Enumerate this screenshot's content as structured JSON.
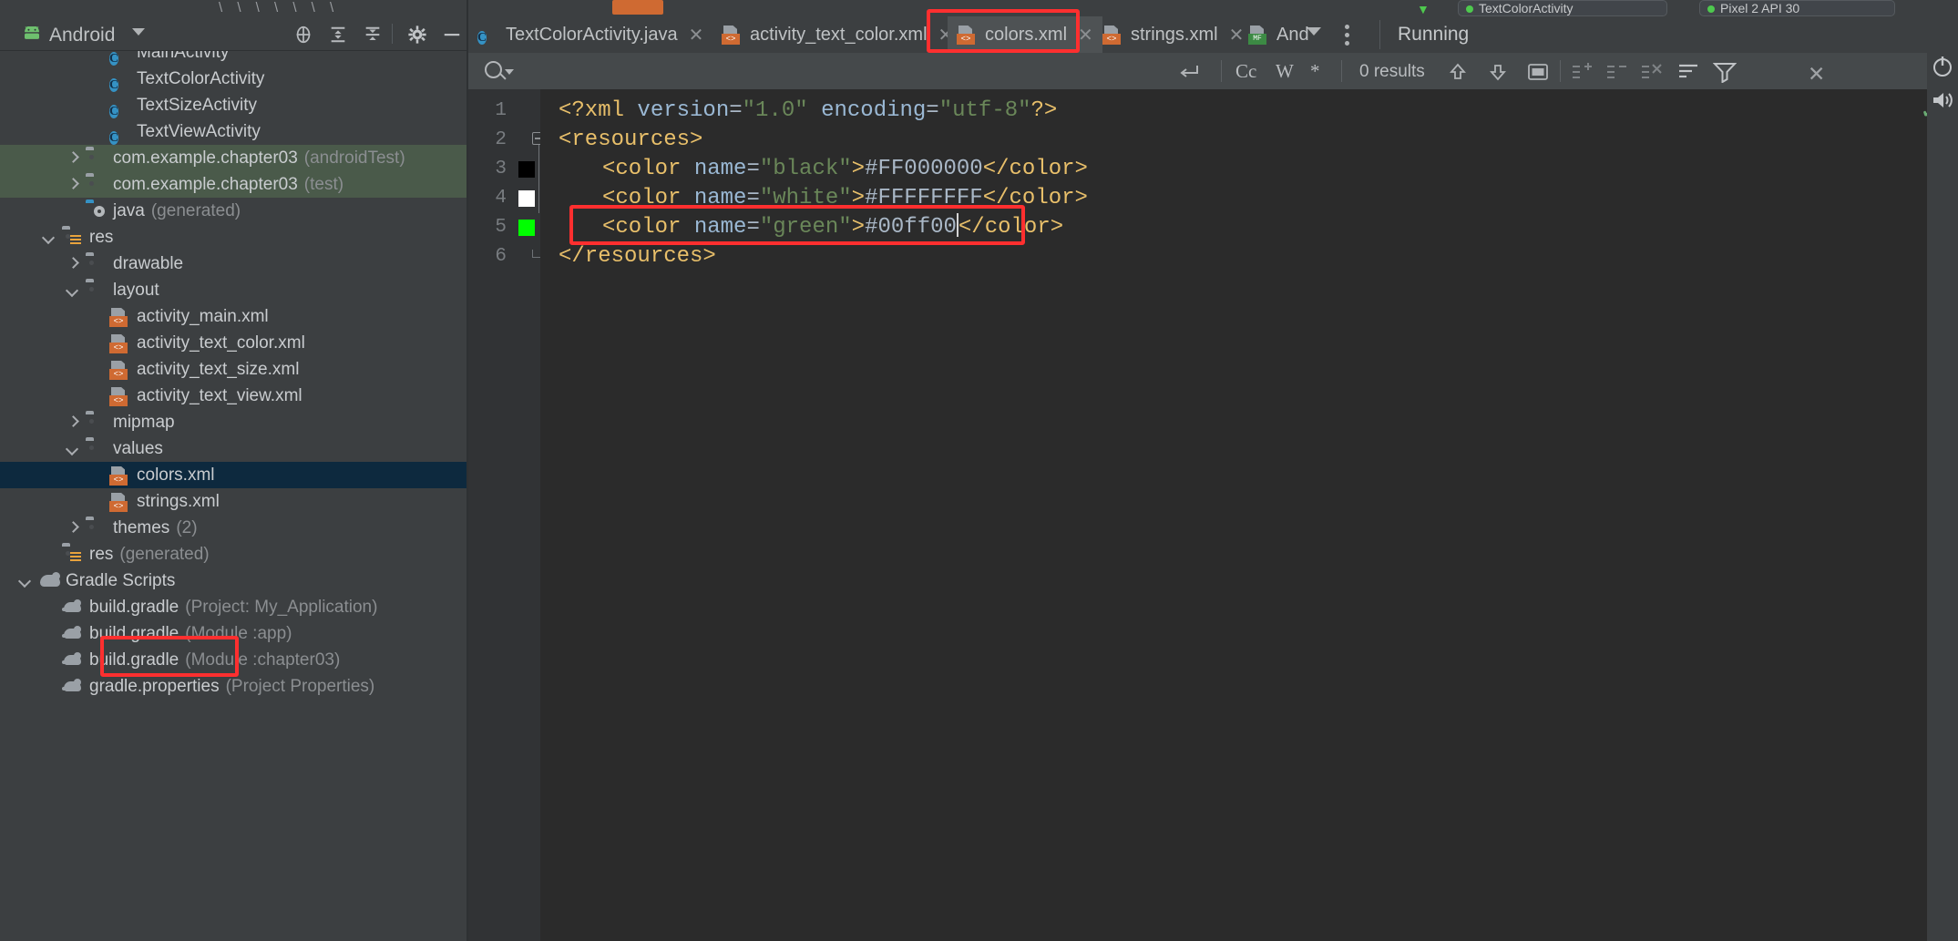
{
  "window": {
    "background": "#3c3f41",
    "editor_background": "#2b2b2b"
  },
  "top_sliver": {
    "breadcrumb_separators": "\\   \\   \\   \\   \\   \\   \\",
    "chip_running_label": "TextColorActivity",
    "chip_device_label": "Pixel 2 API 30"
  },
  "project_panel": {
    "title": "Android",
    "droid_icon": "android-robot-icon",
    "caret_icon": "chevron-down-icon",
    "header_icons": [
      {
        "name": "locate-in-tree-icon",
        "glyph": "target"
      },
      {
        "name": "expand-all-icon",
        "glyph": "expand"
      },
      {
        "name": "collapse-all-icon",
        "glyph": "collapse"
      },
      {
        "name": "settings-gear-icon",
        "glyph": "gear"
      },
      {
        "name": "hide-panel-icon",
        "glyph": "minus"
      }
    ],
    "tree": [
      {
        "indent": 3,
        "chevron": "none",
        "icon": "java-class-icon",
        "label": "MainActivity",
        "sub": "",
        "state": "normal",
        "cut_top": true
      },
      {
        "indent": 3,
        "chevron": "none",
        "icon": "java-class-icon",
        "label": "TextColorActivity",
        "sub": "",
        "state": "normal"
      },
      {
        "indent": 3,
        "chevron": "none",
        "icon": "java-class-icon",
        "label": "TextSizeActivity",
        "sub": "",
        "state": "normal"
      },
      {
        "indent": 3,
        "chevron": "none",
        "icon": "java-class-icon",
        "label": "TextViewActivity",
        "sub": "",
        "state": "normal"
      },
      {
        "indent": 2,
        "chevron": "right",
        "icon": "folder-icon",
        "label": "com.example.chapter03",
        "sub": "(androidTest)",
        "state": "selected-green"
      },
      {
        "indent": 2,
        "chevron": "right",
        "icon": "folder-icon",
        "label": "com.example.chapter03",
        "sub": "(test)",
        "state": "selected-green"
      },
      {
        "indent": 2,
        "chevron": "none",
        "icon": "java-generated-folder-icon",
        "label": "java",
        "sub": "(generated)",
        "state": "normal"
      },
      {
        "indent": 1,
        "chevron": "down",
        "icon": "res-folder-icon",
        "label": "res",
        "sub": "",
        "state": "normal"
      },
      {
        "indent": 2,
        "chevron": "right",
        "icon": "folder-icon",
        "label": "drawable",
        "sub": "",
        "state": "normal"
      },
      {
        "indent": 2,
        "chevron": "down",
        "icon": "folder-icon",
        "label": "layout",
        "sub": "",
        "state": "normal"
      },
      {
        "indent": 3,
        "chevron": "none",
        "icon": "xml-layout-icon",
        "label": "activity_main.xml",
        "sub": "",
        "state": "normal"
      },
      {
        "indent": 3,
        "chevron": "none",
        "icon": "xml-layout-icon",
        "label": "activity_text_color.xml",
        "sub": "",
        "state": "normal"
      },
      {
        "indent": 3,
        "chevron": "none",
        "icon": "xml-layout-icon",
        "label": "activity_text_size.xml",
        "sub": "",
        "state": "normal"
      },
      {
        "indent": 3,
        "chevron": "none",
        "icon": "xml-layout-icon",
        "label": "activity_text_view.xml",
        "sub": "",
        "state": "normal"
      },
      {
        "indent": 2,
        "chevron": "right",
        "icon": "folder-icon",
        "label": "mipmap",
        "sub": "",
        "state": "normal"
      },
      {
        "indent": 2,
        "chevron": "down",
        "icon": "folder-icon",
        "label": "values",
        "sub": "",
        "state": "normal"
      },
      {
        "indent": 3,
        "chevron": "none",
        "icon": "xml-layout-icon",
        "label": "colors.xml",
        "sub": "",
        "state": "selected-blue",
        "annotated": true
      },
      {
        "indent": 3,
        "chevron": "none",
        "icon": "xml-layout-icon",
        "label": "strings.xml",
        "sub": "",
        "state": "normal"
      },
      {
        "indent": 2,
        "chevron": "right",
        "icon": "folder-icon",
        "label": "themes",
        "sub": "(2)",
        "state": "normal"
      },
      {
        "indent": 1,
        "chevron": "none",
        "icon": "res-generated-folder-icon",
        "label": "res",
        "sub": "(generated)",
        "state": "normal"
      },
      {
        "indent": 0,
        "chevron": "down",
        "icon": "gradle-scripts-icon",
        "label": "Gradle Scripts",
        "sub": "",
        "state": "normal"
      },
      {
        "indent": 1,
        "chevron": "none",
        "icon": "gradle-file-icon",
        "label": "build.gradle",
        "sub": "(Project: My_Application)",
        "state": "normal"
      },
      {
        "indent": 1,
        "chevron": "none",
        "icon": "gradle-file-icon",
        "label": "build.gradle",
        "sub": "(Module :app)",
        "state": "normal"
      },
      {
        "indent": 1,
        "chevron": "none",
        "icon": "gradle-file-icon",
        "label": "build.gradle",
        "sub": "(Module :chapter03)",
        "state": "normal"
      },
      {
        "indent": 1,
        "chevron": "none",
        "icon": "gradle-file-icon",
        "label": "gradle.properties",
        "sub": "(Project Properties)",
        "state": "normal",
        "cut_bottom": true
      }
    ]
  },
  "editor": {
    "tabs": [
      {
        "label": "TextColorActivity.java",
        "icon": "java-class-icon",
        "active": false,
        "closable": true
      },
      {
        "label": "activity_text_color.xml",
        "icon": "xml-layout-icon",
        "active": false,
        "closable": true
      },
      {
        "label": "colors.xml",
        "icon": "xml-layout-icon",
        "active": true,
        "closable": true,
        "annotated": true
      },
      {
        "label": "strings.xml",
        "icon": "xml-layout-icon",
        "active": false,
        "closable": true
      },
      {
        "label": "And",
        "icon": "manifest-icon",
        "active": false,
        "closable": false
      }
    ],
    "tab_overflow_icon": "chevron-down-icon",
    "tab_kebab_icon": "more-options-icon",
    "running_label": "Running",
    "findbar": {
      "search_value": "",
      "search_placeholder": "",
      "magnifier_icon": "search-icon",
      "history_caret_icon": "chevron-down-icon",
      "regex_newline_icon": "multiline-icon",
      "match_case_label": "Cc",
      "words_label": "W",
      "regex_label": "*",
      "results_text": "0 results",
      "prev_icon": "arrow-up-icon",
      "next_icon": "arrow-down-icon",
      "select_all_icon": "select-all-occurrences-icon",
      "add_line_icon": "add-line-icon",
      "remove_line_icon": "remove-line-icon",
      "exclude_icon": "exclude-icon",
      "filter_lines_icon": "filter-lines-icon",
      "filter_icon": "filter-icon",
      "close_icon": "close-icon"
    },
    "inspection_ok_icon": "checkmark-ok-icon",
    "code": {
      "language": "xml",
      "lines": [
        {
          "num": "1",
          "swatch": null,
          "fold": "none",
          "indent": 0,
          "tokens": [
            {
              "t": "<?xml ",
              "c": "decl"
            },
            {
              "t": "version",
              "c": "attrn"
            },
            {
              "t": "=",
              "c": "punct"
            },
            {
              "t": "\"1.0\"",
              "c": "val"
            },
            {
              "t": " ",
              "c": "punct"
            },
            {
              "t": "encoding",
              "c": "attrn"
            },
            {
              "t": "=",
              "c": "punct"
            },
            {
              "t": "\"utf-8\"",
              "c": "val"
            },
            {
              "t": "?>",
              "c": "decl"
            }
          ]
        },
        {
          "num": "2",
          "swatch": null,
          "fold": "start",
          "indent": 0,
          "tokens": [
            {
              "t": "<resources>",
              "c": "tag"
            }
          ]
        },
        {
          "num": "3",
          "swatch": "#000000",
          "fold": "none",
          "indent": 1,
          "tokens": [
            {
              "t": "<color ",
              "c": "tag"
            },
            {
              "t": "name",
              "c": "attrn"
            },
            {
              "t": "=",
              "c": "punct"
            },
            {
              "t": "\"black\"",
              "c": "val"
            },
            {
              "t": ">",
              "c": "tag"
            },
            {
              "t": "#FF000000",
              "c": "text"
            },
            {
              "t": "</color>",
              "c": "tag"
            }
          ]
        },
        {
          "num": "4",
          "swatch": "#FFFFFF",
          "fold": "none",
          "indent": 1,
          "tokens": [
            {
              "t": "<color ",
              "c": "tag"
            },
            {
              "t": "name",
              "c": "attrn"
            },
            {
              "t": "=",
              "c": "punct"
            },
            {
              "t": "\"white\"",
              "c": "val"
            },
            {
              "t": ">",
              "c": "tag"
            },
            {
              "t": "#FFFFFFFF",
              "c": "text"
            },
            {
              "t": "</color>",
              "c": "tag"
            }
          ]
        },
        {
          "num": "5",
          "swatch": "#00ff00",
          "fold": "none",
          "indent": 1,
          "annotated": true,
          "caret_after": 6,
          "tokens": [
            {
              "t": "<color ",
              "c": "tag"
            },
            {
              "t": "name",
              "c": "attrn"
            },
            {
              "t": "=",
              "c": "punct"
            },
            {
              "t": "\"green\"",
              "c": "val"
            },
            {
              "t": ">",
              "c": "tag"
            },
            {
              "t": "#00ff00",
              "c": "text"
            },
            {
              "t": "</color>",
              "c": "tag"
            }
          ]
        },
        {
          "num": "6",
          "swatch": null,
          "fold": "end",
          "indent": 0,
          "tokens": [
            {
              "t": "</resources>",
              "c": "tag"
            }
          ]
        }
      ]
    }
  },
  "right_sidebar": {
    "power_icon": "power-icon",
    "volume_icon": "volume-icon"
  },
  "annotations": {
    "color": "#ff2f2f",
    "boxes": [
      "tab-colors-xml",
      "tree-colors-xml",
      "code-line-5"
    ]
  }
}
